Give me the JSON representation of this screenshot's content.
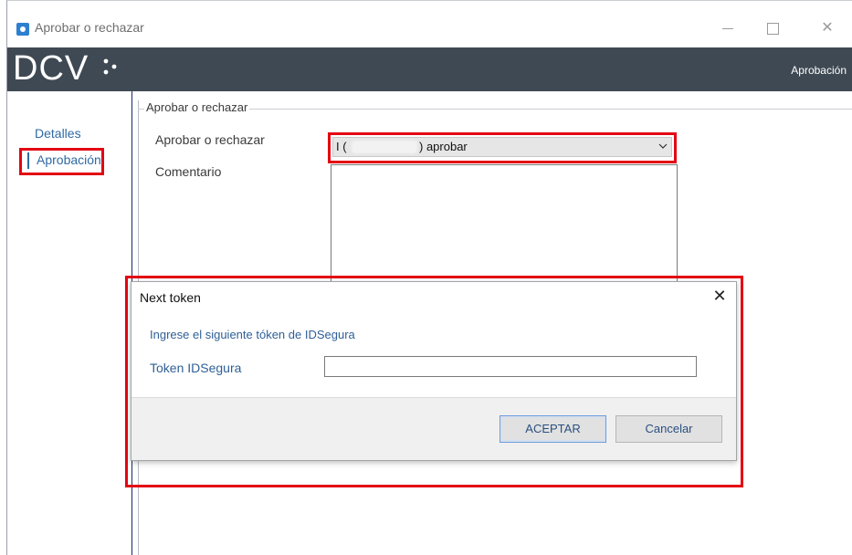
{
  "window": {
    "title": "Aprobar o rechazar",
    "controls": {
      "minimize_icon": "minimize-icon",
      "maximize_icon": "maximize-icon",
      "close_icon": "close-icon",
      "close_glyph": "✕"
    }
  },
  "header": {
    "logo_text": "DCV",
    "section_label": "Aprobación",
    "band_color": "#3f4953"
  },
  "sidebar": {
    "items": [
      {
        "label": "Detalles"
      },
      {
        "label": "Aprobación",
        "active": true
      }
    ]
  },
  "form": {
    "group_title": "Aprobar o rechazar",
    "approve_label": "Aprobar o rechazar",
    "approve_value_prefix": "I (",
    "approve_value_suffix": ") aprobar",
    "comment_label": "Comentario",
    "comment_value": ""
  },
  "dialog": {
    "title": "Next token",
    "close_glyph": "✕",
    "prompt": "Ingrese el siguiente tóken de IDSegura",
    "token_label": "Token IDSegura",
    "token_value": "",
    "ok_label": "ACEPTAR",
    "cancel_label": "Cancelar"
  },
  "highlights": {
    "color": "#e30613"
  }
}
